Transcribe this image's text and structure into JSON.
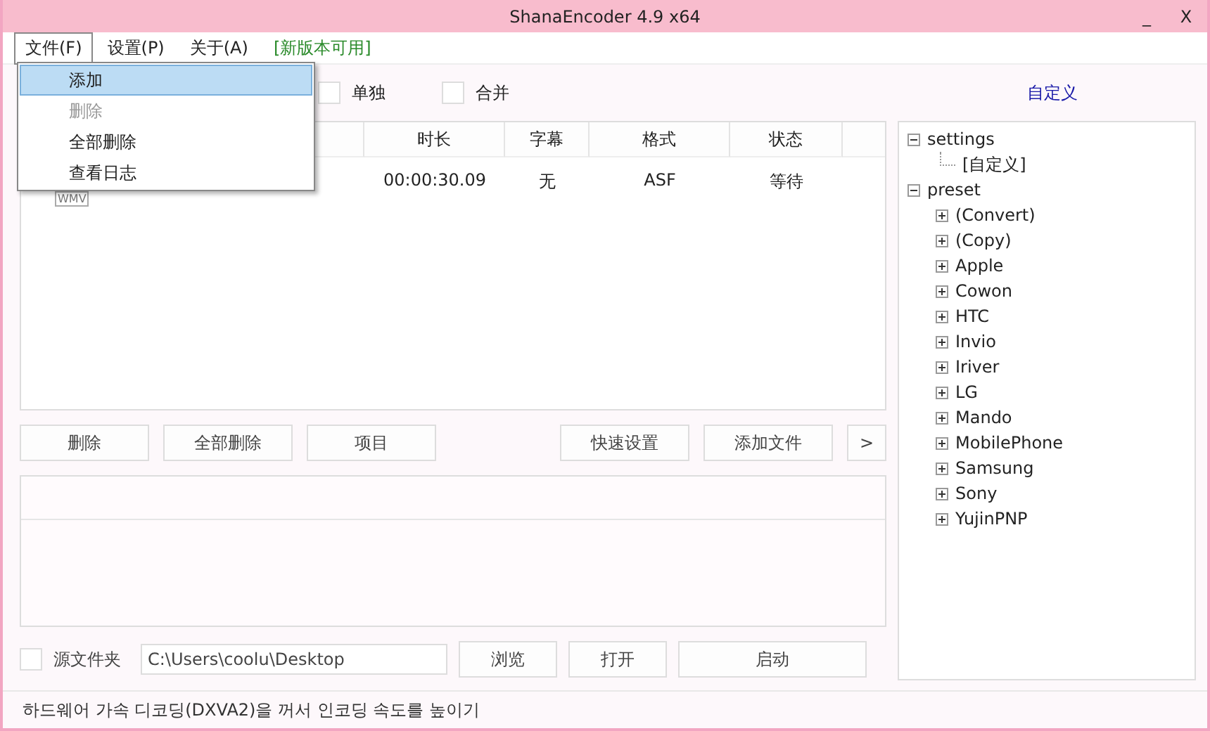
{
  "window": {
    "title": "ShanaEncoder 4.9 x64",
    "controls": [
      "_",
      "X"
    ]
  },
  "menubar": [
    {
      "label": "文件(F)",
      "expanded": true
    },
    {
      "label": "设置(P)",
      "expanded": false
    },
    {
      "label": "关于(A)",
      "expanded": false
    },
    {
      "label": "[新版本可用]",
      "kind": "notice",
      "expanded": false
    }
  ],
  "file_menu": [
    {
      "label": "添加",
      "selected": true,
      "disabled": false
    },
    {
      "label": "删除",
      "selected": false,
      "disabled": true
    },
    {
      "label": "全部删除",
      "selected": false,
      "disabled": false
    },
    {
      "label": "查看日志",
      "selected": false,
      "disabled": false
    }
  ],
  "options": [
    {
      "label": "单独",
      "checked": false
    },
    {
      "label": "合并",
      "checked": false
    }
  ],
  "preset_link": "自定义",
  "table": {
    "columns": [
      "时长",
      "字幕",
      "格式",
      "状态"
    ],
    "rows": [
      {
        "badge": "WMV",
        "cells": [
          "00:00:30.09",
          "无",
          "ASF",
          "等待"
        ]
      }
    ]
  },
  "list_buttons": [
    "删除",
    "全部删除",
    "项目"
  ],
  "right_buttons": [
    "快速设置",
    "添加文件",
    ">"
  ],
  "output": {
    "checkbox_label": "源文件夹",
    "checked": false,
    "path": "C:\\Users\\coolu\\Desktop",
    "buttons": [
      "浏览",
      "打开"
    ],
    "start": "启动"
  },
  "tree": [
    {
      "label": "settings",
      "expanded": true,
      "children": [
        {
          "label": "[自定义]"
        }
      ]
    },
    {
      "label": "preset",
      "expanded": true,
      "children": [
        {
          "label": "(Convert)",
          "expanded": false
        },
        {
          "label": "(Copy)",
          "expanded": false
        },
        {
          "label": "Apple",
          "expanded": false
        },
        {
          "label": "Cowon",
          "expanded": false
        },
        {
          "label": "HTC",
          "expanded": false
        },
        {
          "label": "Invio",
          "expanded": false
        },
        {
          "label": "Iriver",
          "expanded": false
        },
        {
          "label": "LG",
          "expanded": false
        },
        {
          "label": "Mando",
          "expanded": false
        },
        {
          "label": "MobilePhone",
          "expanded": false
        },
        {
          "label": "Samsung",
          "expanded": false
        },
        {
          "label": "Sony",
          "expanded": false
        },
        {
          "label": "YujinPNP",
          "expanded": false
        }
      ]
    }
  ],
  "status_bar": "하드웨어 가속 디코딩(DXVA2)을 꺼서 인코딩 속도를 높이기"
}
